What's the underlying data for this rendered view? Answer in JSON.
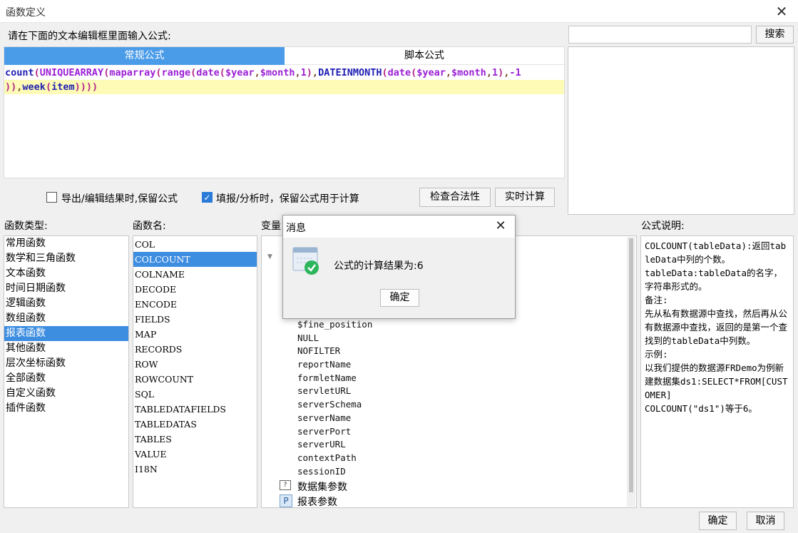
{
  "window": {
    "title": "函数定义"
  },
  "prompt_label": "请在下面的文本编辑框里面输入公式:",
  "search": {
    "placeholder": "",
    "button": "搜索"
  },
  "tabs": [
    "常规公式",
    "脚本公式"
  ],
  "formula": {
    "line1": "count(UNIQUEARRAY(maparray(range(date($year,$month,1),DATEINMONTH(date($year,$month,1),-1",
    "line2": ")),week(item))))"
  },
  "options": {
    "keep_formula_on_export": {
      "label": "导出/编辑结果时,保留公式",
      "checked": false
    },
    "keep_formula_on_fill": {
      "label": "填报/分析时，保留公式用于计算",
      "checked": true
    }
  },
  "buttons": {
    "check": "检查合法性",
    "realtime": "实时计算",
    "ok": "确定",
    "cancel": "取消"
  },
  "sections": {
    "func_type": "函数类型:",
    "func_name": "函数名:",
    "variable": "变量",
    "description": "公式说明:"
  },
  "func_types": [
    "常用函数",
    "数学和三角函数",
    "文本函数",
    "时间日期函数",
    "逻辑函数",
    "数组函数",
    "报表函数",
    "其他函数",
    "层次坐标函数",
    "全部函数",
    "自定义函数",
    "插件函数"
  ],
  "func_types_selected": "报表函数",
  "func_names": [
    "COL",
    "COLCOUNT",
    "COLNAME",
    "DECODE",
    "ENCODE",
    "FIELDS",
    "MAP",
    "RECORDS",
    "ROW",
    "ROWCOUNT",
    "SQL",
    "TABLEDATAFIELDS",
    "TABLEDATAS",
    "TABLES",
    "VALUE",
    "I18N"
  ],
  "func_names_selected": "COLCOUNT",
  "variables": [
    "$fine_position",
    "NULL",
    "NOFILTER",
    "reportName",
    "formletName",
    "servletURL",
    "serverSchema",
    "serverName",
    "serverPort",
    "serverURL",
    "contextPath",
    "sessionID"
  ],
  "var_groups": [
    "数据集参数",
    "报表参数"
  ],
  "description": "COLCOUNT(tableData):返回tableData中列的个数。\ntableData:tableData的名字，字符串形式的。\n备注:\n先从私有数据源中查找，然后再从公有数据源中查找，返回的是第一个查找到的tableData中列数。\n示例:\n以我们提供的数据源FRDemo为例新建数据集ds1:SELECT*FROM[CUSTOMER]\nCOLCOUNT(\"ds1\")等于6。",
  "message_dialog": {
    "title": "消息",
    "text": "公式的计算结果为:6",
    "ok": "确定"
  }
}
